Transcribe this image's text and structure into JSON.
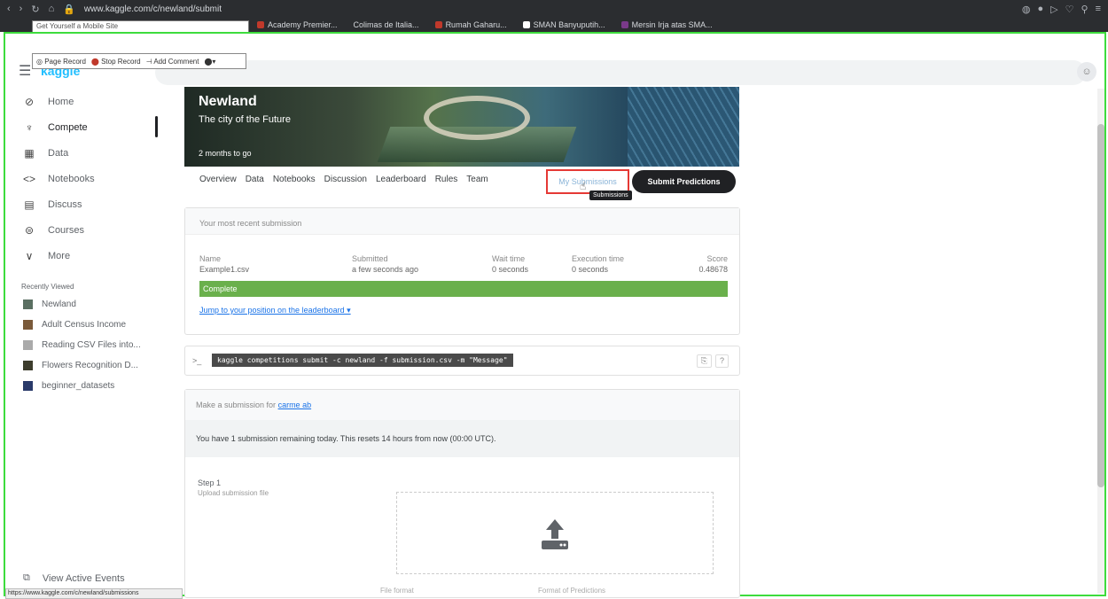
{
  "browser": {
    "url": "www.kaggle.com/c/newland/submit",
    "bookmarks": [
      "Academy Premier...",
      "Colimas de Italia...",
      "Rumah Gaharu...",
      "SMAN Banyuputih...",
      "Mersin Irja atas SMA..."
    ],
    "tooltip_text": "Get Yourself a Mobile Site",
    "status_url": "https://www.kaggle.com/c/newland/submissions"
  },
  "extension_toolbar": {
    "items": [
      "Page Record",
      "Stop Record",
      "Add Comment"
    ]
  },
  "kaggle": {
    "logo": "kaggle"
  },
  "sidebar": {
    "items": [
      {
        "label": "Home",
        "icon": "home-icon",
        "glyph": "⊘"
      },
      {
        "label": "Compete",
        "icon": "trophy-icon",
        "glyph": "♆"
      },
      {
        "label": "Data",
        "icon": "table-icon",
        "glyph": "▦"
      },
      {
        "label": "Notebooks",
        "icon": "code-icon",
        "glyph": "<>"
      },
      {
        "label": "Discuss",
        "icon": "comment-icon",
        "glyph": "▤"
      },
      {
        "label": "Courses",
        "icon": "school-icon",
        "glyph": "⊜"
      },
      {
        "label": "More",
        "icon": "chevron-down-icon",
        "glyph": "∨"
      }
    ],
    "recent_header": "Recently Viewed",
    "recent": [
      {
        "label": "Newland",
        "color": "#5a6f62"
      },
      {
        "label": "Adult Census Income",
        "color": "#7a5a3a"
      },
      {
        "label": "Reading CSV Files into...",
        "color": "#aaaaaa"
      },
      {
        "label": "Flowers Recognition D...",
        "color": "#3d3d2d"
      },
      {
        "label": "beginner_datasets",
        "color": "#2a3a6a"
      }
    ],
    "view_active": "View Active Events"
  },
  "competition": {
    "title": "Newland",
    "subtitle": "The city of the Future",
    "time_left": "2 months to go",
    "tabs": [
      "Overview",
      "Data",
      "Notebooks",
      "Discussion",
      "Leaderboard",
      "Rules",
      "Team"
    ],
    "my_submissions": "My Submissions",
    "cursor_tooltip": "Submissions",
    "submit_button": "Submit Predictions"
  },
  "recent_submission": {
    "header": "Your most recent submission",
    "columns": [
      "Name",
      "Submitted",
      "Wait time",
      "Execution time",
      "Score"
    ],
    "values": [
      "Example1.csv",
      "a few seconds ago",
      "0 seconds",
      "0 seconds",
      "0.48678"
    ],
    "status": "Complete",
    "jump_link": "Jump to your position on the leaderboard ▾"
  },
  "api": {
    "prompt": ">_",
    "command": "kaggle competitions submit -c newland -f submission.csv -m \"Message\"",
    "copy_items": [
      "⎘",
      "?"
    ]
  },
  "make_submission": {
    "header_prefix": "Make a submission for",
    "header_link": "carme ab",
    "banner": "You have 1 submission remaining today. This resets 14 hours from now (00:00 UTC).",
    "step_title": "Step 1",
    "step_subtitle": "Upload submission file",
    "footer_left": "File format",
    "footer_right": "Format of Predictions"
  },
  "colors": {
    "highlight": "#e53935",
    "complete": "#6ab04c",
    "frame": "#3ddc3d"
  }
}
